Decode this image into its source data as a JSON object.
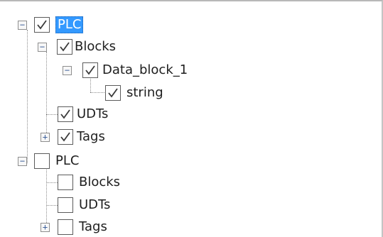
{
  "tree": {
    "nodes": [
      {
        "label": "PLC",
        "checked": true,
        "expander": "minus",
        "selected": true
      },
      {
        "label": "Blocks",
        "checked": true,
        "expander": "minus"
      },
      {
        "label": "Data_block_1",
        "checked": true,
        "expander": "minus"
      },
      {
        "label": "string",
        "checked": true,
        "expander": "none"
      },
      {
        "label": "UDTs",
        "checked": true,
        "expander": "none"
      },
      {
        "label": "Tags",
        "checked": true,
        "expander": "plus"
      },
      {
        "label": "PLC",
        "checked": false,
        "expander": "minus"
      },
      {
        "label": "Blocks",
        "checked": false,
        "expander": "none"
      },
      {
        "label": "UDTs",
        "checked": false,
        "expander": "none"
      },
      {
        "label": "Tags",
        "checked": false,
        "expander": "plus"
      }
    ]
  },
  "expander_symbols": {
    "minus": "−",
    "plus": "+"
  },
  "colors": {
    "selection": "#3399ff",
    "check": "#3a3a3a",
    "connector": "#8c8c8c"
  }
}
